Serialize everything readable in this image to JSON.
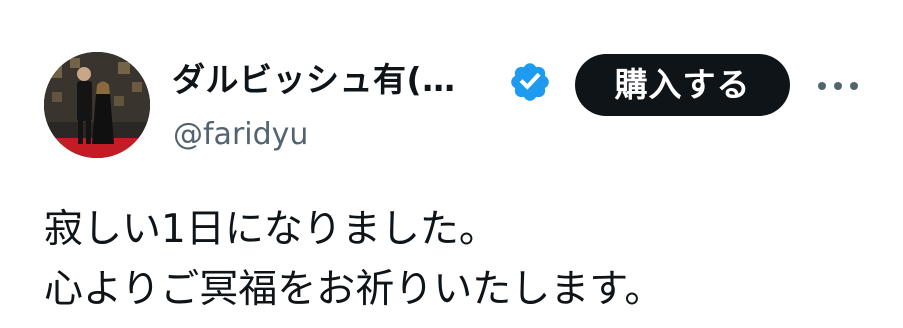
{
  "author": {
    "display_name": "ダルビッシュ有(…",
    "handle": "@faridyu",
    "verified": true
  },
  "actions": {
    "buy_label": "購入する",
    "more_icon": "more-horizontal-icon"
  },
  "tweet": {
    "lines": [
      "寂しい1日になりました。",
      "心よりご冥福をお祈りいたします。"
    ]
  },
  "colors": {
    "text_primary": "#0f1419",
    "text_secondary": "#536471",
    "verified_blue": "#1d9bf0",
    "button_bg": "#0f1419",
    "button_text": "#ffffff"
  }
}
